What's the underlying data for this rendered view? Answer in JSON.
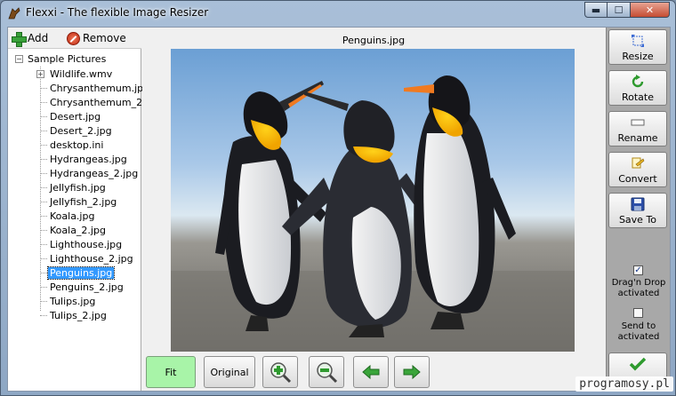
{
  "window": {
    "title": "Flexxi - The flexible Image Resizer"
  },
  "toolbar": {
    "add_label": "Add",
    "remove_label": "Remove"
  },
  "tree": {
    "root": "Sample Pictures",
    "items": [
      {
        "label": "Wildlife.wmv",
        "expandable": true
      },
      {
        "label": "Chrysanthemum.jpg"
      },
      {
        "label": "Chrysanthemum_2.jpg"
      },
      {
        "label": "Desert.jpg"
      },
      {
        "label": "Desert_2.jpg"
      },
      {
        "label": "desktop.ini"
      },
      {
        "label": "Hydrangeas.jpg"
      },
      {
        "label": "Hydrangeas_2.jpg"
      },
      {
        "label": "Jellyfish.jpg"
      },
      {
        "label": "Jellyfish_2.jpg"
      },
      {
        "label": "Koala.jpg"
      },
      {
        "label": "Koala_2.jpg"
      },
      {
        "label": "Lighthouse.jpg"
      },
      {
        "label": "Lighthouse_2.jpg"
      },
      {
        "label": "Penguins.jpg",
        "selected": true
      },
      {
        "label": "Penguins_2.jpg"
      },
      {
        "label": "Tulips.jpg"
      },
      {
        "label": "Tulips_2.jpg"
      }
    ]
  },
  "preview": {
    "caption": "Penguins.jpg"
  },
  "bottom_bar": {
    "fit_label": "Fit",
    "original_label": "Original"
  },
  "actions": {
    "resize": "Resize",
    "rotate": "Rotate",
    "rename": "Rename",
    "convert": "Convert",
    "save_to": "Save To"
  },
  "options": {
    "drag_drop": {
      "label_1": "Drag'n Drop",
      "label_2": "activated",
      "checked": true
    },
    "send_to": {
      "label_1": "Send to",
      "label_2": "activated",
      "checked": false
    }
  },
  "watermark": "programosy.pl",
  "colors": {
    "fit_button": "#a8f4a8",
    "selection": "#3399ff",
    "right_panel": "#a8a8a8"
  }
}
